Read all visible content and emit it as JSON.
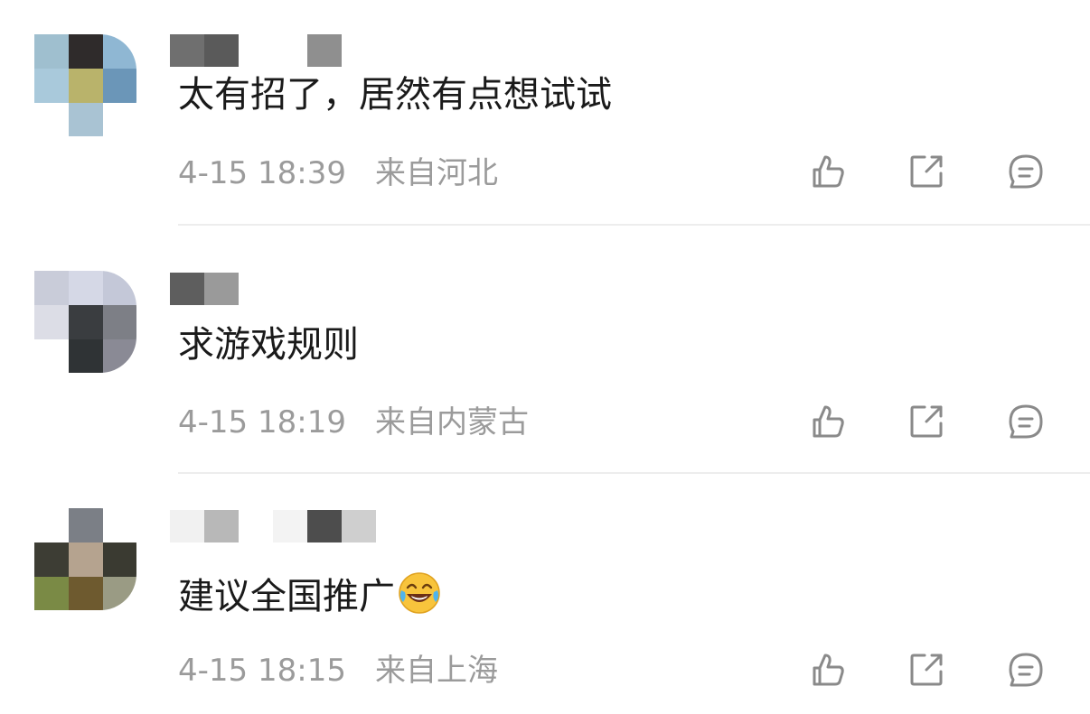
{
  "comments": [
    {
      "text": "太有招了，居然有点想试试",
      "time": "4-15 18:39",
      "location": "来自河北",
      "avatar_colors": [
        "#9fbfcf",
        "#2f2b2b",
        "#8fb7d3",
        "#a9c9db",
        "#b9b36b",
        "#6b96b8",
        "#ffffff",
        "#a9c3d3",
        "#ffffff"
      ],
      "name_colors": [
        "#6f6f6f",
        "#5a5a5a",
        "#ffffff",
        "#ffffff",
        "#8f8f8f",
        "#ffffff"
      ]
    },
    {
      "text": "求游戏规则",
      "time": "4-15 18:19",
      "location": "来自内蒙古",
      "avatar_colors": [
        "#c9ccd9",
        "#d5d8e6",
        "#c4c8d8",
        "#dcdde6",
        "#3a3d40",
        "#7d7f86",
        "#ffffff",
        "#2f3335",
        "#8a8a95"
      ],
      "name_colors": [
        "#5e5e5e",
        "#9a9a9a",
        "#ffffff",
        "#ffffff",
        "#ffffff",
        "#ffffff"
      ]
    },
    {
      "text": "建议全国推广",
      "emoji": "face-with-tears-of-joy",
      "time": "4-15 18:15",
      "location": "来自上海",
      "avatar_colors": [
        "#ffffff",
        "#7b7f86",
        "#ffffff",
        "#3d3d34",
        "#b5a38f",
        "#3a3a31",
        "#7a8a45",
        "#6e5a2f",
        "#9a9b84"
      ],
      "name_colors": [
        "#f1f1f1",
        "#b8b8b8",
        "#ffffff",
        "#f3f3f3",
        "#4d4d4d",
        "#cfcfcf"
      ]
    }
  ],
  "actions": {
    "like": "like-icon",
    "share": "share-icon",
    "reply": "reply-icon"
  }
}
